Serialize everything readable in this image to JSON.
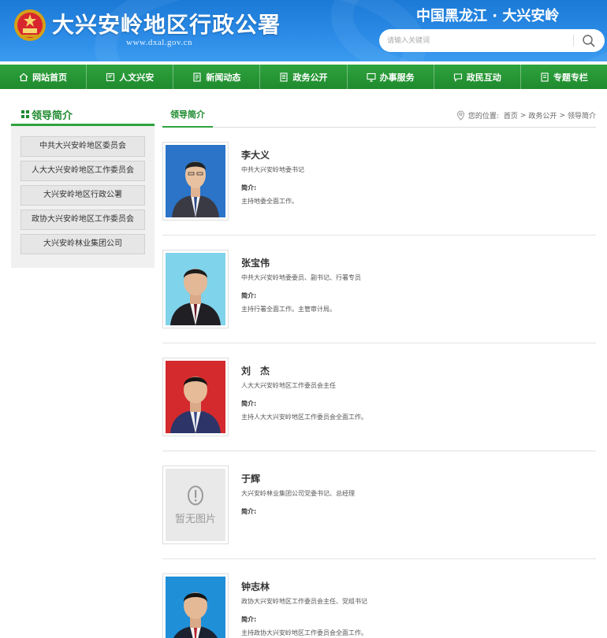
{
  "header": {
    "site_title": "大兴安岭地区行政公署",
    "site_url": "www.dxal.gov.cn",
    "slogan": "中国黑龙江 · 大兴安岭",
    "search_placeholder": "请输入关键词",
    "emblem_icon": "national-emblem-icon",
    "colors": {
      "header_blue": "#1b7ad6",
      "nav_green": "#2fa33e"
    }
  },
  "nav": {
    "items": [
      {
        "label": "网站首页",
        "icon": "home-icon"
      },
      {
        "label": "人文兴安",
        "icon": "book-icon"
      },
      {
        "label": "新闻动态",
        "icon": "news-icon"
      },
      {
        "label": "政务公开",
        "icon": "document-icon"
      },
      {
        "label": "办事服务",
        "icon": "monitor-icon"
      },
      {
        "label": "政民互动",
        "icon": "chat-icon"
      },
      {
        "label": "专题专栏",
        "icon": "folder-icon"
      }
    ]
  },
  "sidebar": {
    "heading": "领导简介",
    "items": [
      "中共大兴安岭地区委员会",
      "人大大兴安岭地区工作委员会",
      "大兴安岭地区行政公署",
      "政协大兴安岭地区工作委员会",
      "大兴安岭林业集团公司"
    ]
  },
  "main": {
    "tab_label": "领导简介",
    "breadcrumb": {
      "prefix": "您的位置:",
      "items": [
        "首页",
        "政务公开",
        "领导简介"
      ],
      "separator": ">"
    },
    "intro_label": "简介:",
    "no_image_text": "暂无图片",
    "leaders": [
      {
        "name": "李大义",
        "title": "中共大兴安岭地委书记",
        "intro": "主持地委全面工作。",
        "photo": "portrait"
      },
      {
        "name": "张宝伟",
        "title": "中共大兴安岭地委委员、副书记、行署专员",
        "intro": "主持行署全面工作。主管审计局。",
        "photo": "portrait"
      },
      {
        "name": "刘　杰",
        "title": "人大大兴安岭地区工作委员会主任",
        "intro": "主持人大大兴安岭地区工作委员会全面工作。",
        "photo": "portrait"
      },
      {
        "name": "于辉",
        "title": "大兴安岭林业集团公司党委书记、总经理",
        "intro": "",
        "photo": "none"
      },
      {
        "name": "钟志林",
        "title": "政协大兴安岭地区工作委员会主任、党组书记",
        "intro": "主持政协大兴安岭地区工作委员会全面工作。",
        "photo": "portrait"
      }
    ]
  }
}
